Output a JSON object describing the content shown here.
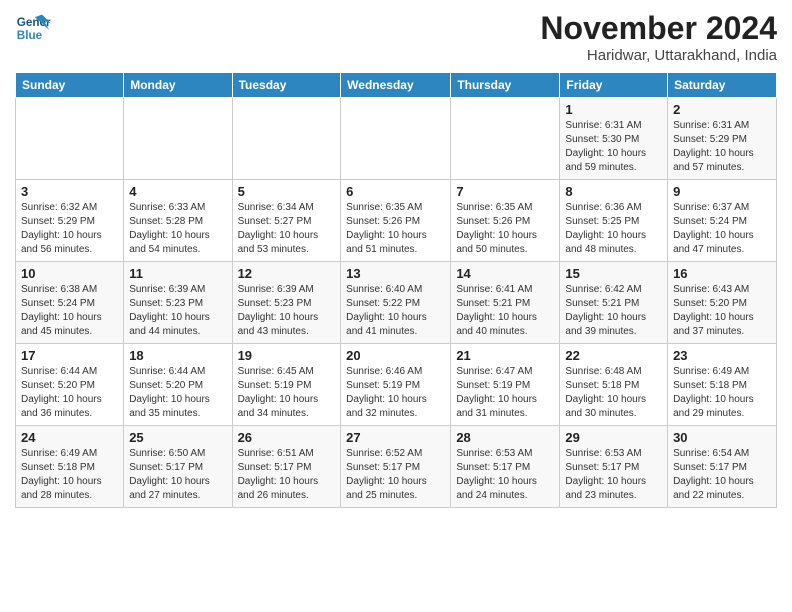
{
  "header": {
    "logo_line1": "General",
    "logo_line2": "Blue",
    "month_title": "November 2024",
    "location": "Haridwar, Uttarakhand, India"
  },
  "weekdays": [
    "Sunday",
    "Monday",
    "Tuesday",
    "Wednesday",
    "Thursday",
    "Friday",
    "Saturday"
  ],
  "weeks": [
    [
      {
        "day": "",
        "info": ""
      },
      {
        "day": "",
        "info": ""
      },
      {
        "day": "",
        "info": ""
      },
      {
        "day": "",
        "info": ""
      },
      {
        "day": "",
        "info": ""
      },
      {
        "day": "1",
        "info": "Sunrise: 6:31 AM\nSunset: 5:30 PM\nDaylight: 10 hours and 59 minutes."
      },
      {
        "day": "2",
        "info": "Sunrise: 6:31 AM\nSunset: 5:29 PM\nDaylight: 10 hours and 57 minutes."
      }
    ],
    [
      {
        "day": "3",
        "info": "Sunrise: 6:32 AM\nSunset: 5:29 PM\nDaylight: 10 hours and 56 minutes."
      },
      {
        "day": "4",
        "info": "Sunrise: 6:33 AM\nSunset: 5:28 PM\nDaylight: 10 hours and 54 minutes."
      },
      {
        "day": "5",
        "info": "Sunrise: 6:34 AM\nSunset: 5:27 PM\nDaylight: 10 hours and 53 minutes."
      },
      {
        "day": "6",
        "info": "Sunrise: 6:35 AM\nSunset: 5:26 PM\nDaylight: 10 hours and 51 minutes."
      },
      {
        "day": "7",
        "info": "Sunrise: 6:35 AM\nSunset: 5:26 PM\nDaylight: 10 hours and 50 minutes."
      },
      {
        "day": "8",
        "info": "Sunrise: 6:36 AM\nSunset: 5:25 PM\nDaylight: 10 hours and 48 minutes."
      },
      {
        "day": "9",
        "info": "Sunrise: 6:37 AM\nSunset: 5:24 PM\nDaylight: 10 hours and 47 minutes."
      }
    ],
    [
      {
        "day": "10",
        "info": "Sunrise: 6:38 AM\nSunset: 5:24 PM\nDaylight: 10 hours and 45 minutes."
      },
      {
        "day": "11",
        "info": "Sunrise: 6:39 AM\nSunset: 5:23 PM\nDaylight: 10 hours and 44 minutes."
      },
      {
        "day": "12",
        "info": "Sunrise: 6:39 AM\nSunset: 5:23 PM\nDaylight: 10 hours and 43 minutes."
      },
      {
        "day": "13",
        "info": "Sunrise: 6:40 AM\nSunset: 5:22 PM\nDaylight: 10 hours and 41 minutes."
      },
      {
        "day": "14",
        "info": "Sunrise: 6:41 AM\nSunset: 5:21 PM\nDaylight: 10 hours and 40 minutes."
      },
      {
        "day": "15",
        "info": "Sunrise: 6:42 AM\nSunset: 5:21 PM\nDaylight: 10 hours and 39 minutes."
      },
      {
        "day": "16",
        "info": "Sunrise: 6:43 AM\nSunset: 5:20 PM\nDaylight: 10 hours and 37 minutes."
      }
    ],
    [
      {
        "day": "17",
        "info": "Sunrise: 6:44 AM\nSunset: 5:20 PM\nDaylight: 10 hours and 36 minutes."
      },
      {
        "day": "18",
        "info": "Sunrise: 6:44 AM\nSunset: 5:20 PM\nDaylight: 10 hours and 35 minutes."
      },
      {
        "day": "19",
        "info": "Sunrise: 6:45 AM\nSunset: 5:19 PM\nDaylight: 10 hours and 34 minutes."
      },
      {
        "day": "20",
        "info": "Sunrise: 6:46 AM\nSunset: 5:19 PM\nDaylight: 10 hours and 32 minutes."
      },
      {
        "day": "21",
        "info": "Sunrise: 6:47 AM\nSunset: 5:19 PM\nDaylight: 10 hours and 31 minutes."
      },
      {
        "day": "22",
        "info": "Sunrise: 6:48 AM\nSunset: 5:18 PM\nDaylight: 10 hours and 30 minutes."
      },
      {
        "day": "23",
        "info": "Sunrise: 6:49 AM\nSunset: 5:18 PM\nDaylight: 10 hours and 29 minutes."
      }
    ],
    [
      {
        "day": "24",
        "info": "Sunrise: 6:49 AM\nSunset: 5:18 PM\nDaylight: 10 hours and 28 minutes."
      },
      {
        "day": "25",
        "info": "Sunrise: 6:50 AM\nSunset: 5:17 PM\nDaylight: 10 hours and 27 minutes."
      },
      {
        "day": "26",
        "info": "Sunrise: 6:51 AM\nSunset: 5:17 PM\nDaylight: 10 hours and 26 minutes."
      },
      {
        "day": "27",
        "info": "Sunrise: 6:52 AM\nSunset: 5:17 PM\nDaylight: 10 hours and 25 minutes."
      },
      {
        "day": "28",
        "info": "Sunrise: 6:53 AM\nSunset: 5:17 PM\nDaylight: 10 hours and 24 minutes."
      },
      {
        "day": "29",
        "info": "Sunrise: 6:53 AM\nSunset: 5:17 PM\nDaylight: 10 hours and 23 minutes."
      },
      {
        "day": "30",
        "info": "Sunrise: 6:54 AM\nSunset: 5:17 PM\nDaylight: 10 hours and 22 minutes."
      }
    ]
  ]
}
